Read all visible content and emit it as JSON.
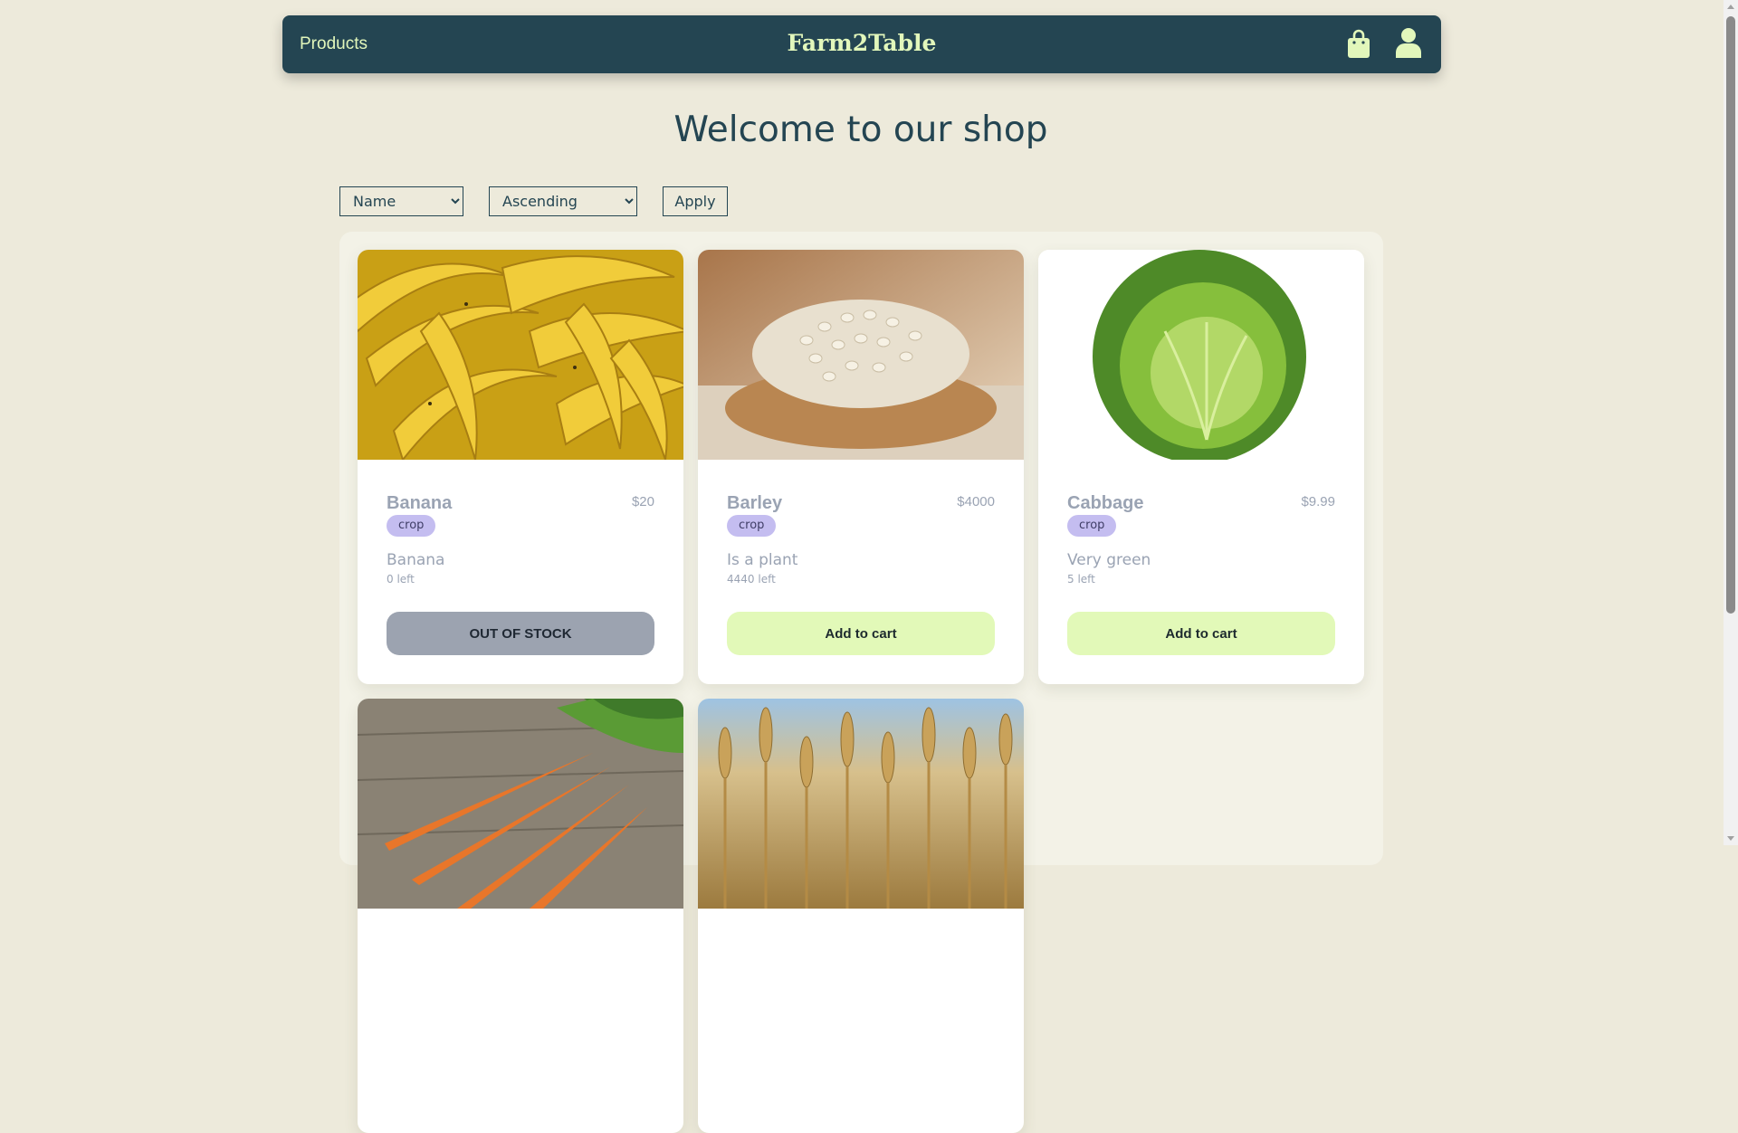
{
  "nav": {
    "products_label": "Products",
    "brand": "Farm2Table",
    "cart_icon": "shopping-bag-icon",
    "account_icon": "user-icon"
  },
  "welcome": "Welcome to our shop",
  "filters": {
    "sort_field": "Name",
    "sort_order": "Ascending",
    "apply_label": "Apply"
  },
  "products": [
    {
      "name": "Banana",
      "price": "$20",
      "tag": "crop",
      "description": "Banana",
      "stock": "0 left",
      "button": "OUT OF STOCK",
      "in_stock": false
    },
    {
      "name": "Barley",
      "price": "$4000",
      "tag": "crop",
      "description": "Is a plant",
      "stock": "4440 left",
      "button": "Add to cart",
      "in_stock": true
    },
    {
      "name": "Cabbage",
      "price": "$9.99",
      "tag": "crop",
      "description": "Very green",
      "stock": "5 left",
      "button": "Add to cart",
      "in_stock": true
    }
  ],
  "colors": {
    "navbar": "#244552",
    "accent": "#e2f7bb",
    "background": "#edeadb",
    "tag": "#c4bdf0",
    "out_of_stock": "#9ca3b0"
  }
}
